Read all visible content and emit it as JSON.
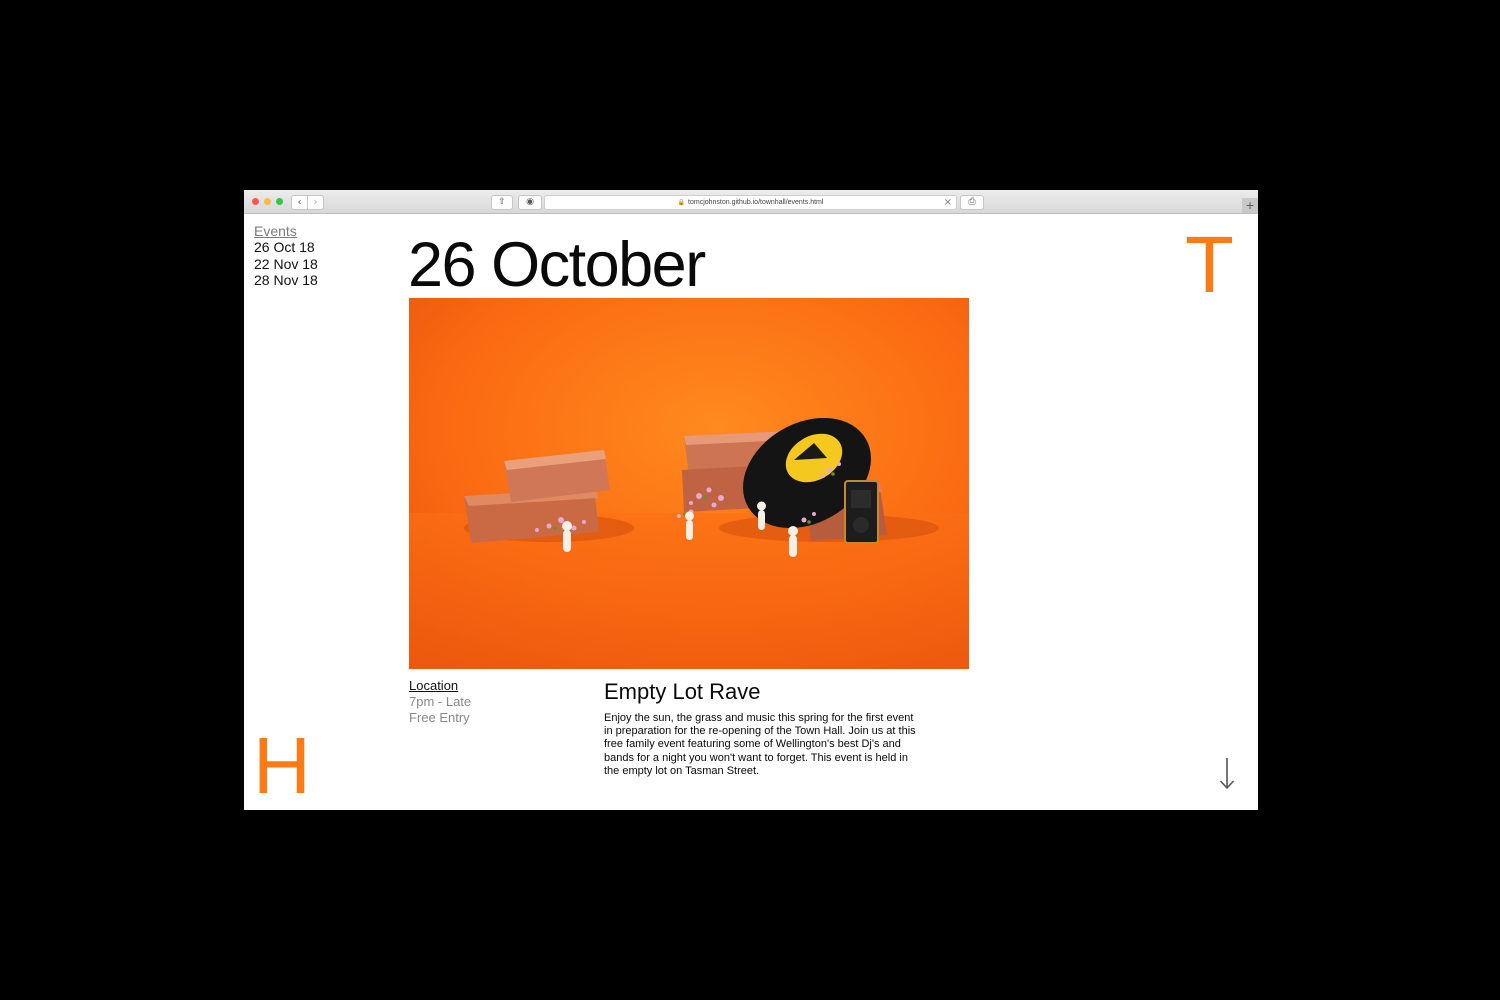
{
  "browser": {
    "url": "tomcjohnston.github.io/townhall/events.html",
    "nav_back": "‹",
    "nav_forward": "›",
    "share_glyph": "⇧",
    "reader_glyph": "◉",
    "print_glyph": "⎙",
    "close_glyph": "×",
    "newtab_glyph": "+",
    "lock_glyph": "🔒"
  },
  "sidebar": {
    "heading": "Events",
    "items": [
      {
        "label": "26 Oct 18"
      },
      {
        "label": "22 Nov 18"
      },
      {
        "label": "28 Nov 18"
      }
    ]
  },
  "main": {
    "date_title": "26 October",
    "details": {
      "location_label": "Location",
      "time": "7pm - Late",
      "price": "Free Entry"
    },
    "event": {
      "title": "Empty Lot Rave",
      "description": "Enjoy the sun, the grass and music this spring for the first event in preparation for the re-opening of the Town Hall. Join us at this free family event featuring some of Wellington's best Dj's and bands for a night you won't want to forget. This event is held in the empty lot on Tasman Street."
    }
  },
  "brand": {
    "letter_top": "T",
    "letter_bottom": "H",
    "accent_color": "#ff7a12"
  },
  "icons": {
    "scroll": "arrow-down-icon",
    "photo": "event-photo-bricks-record"
  }
}
